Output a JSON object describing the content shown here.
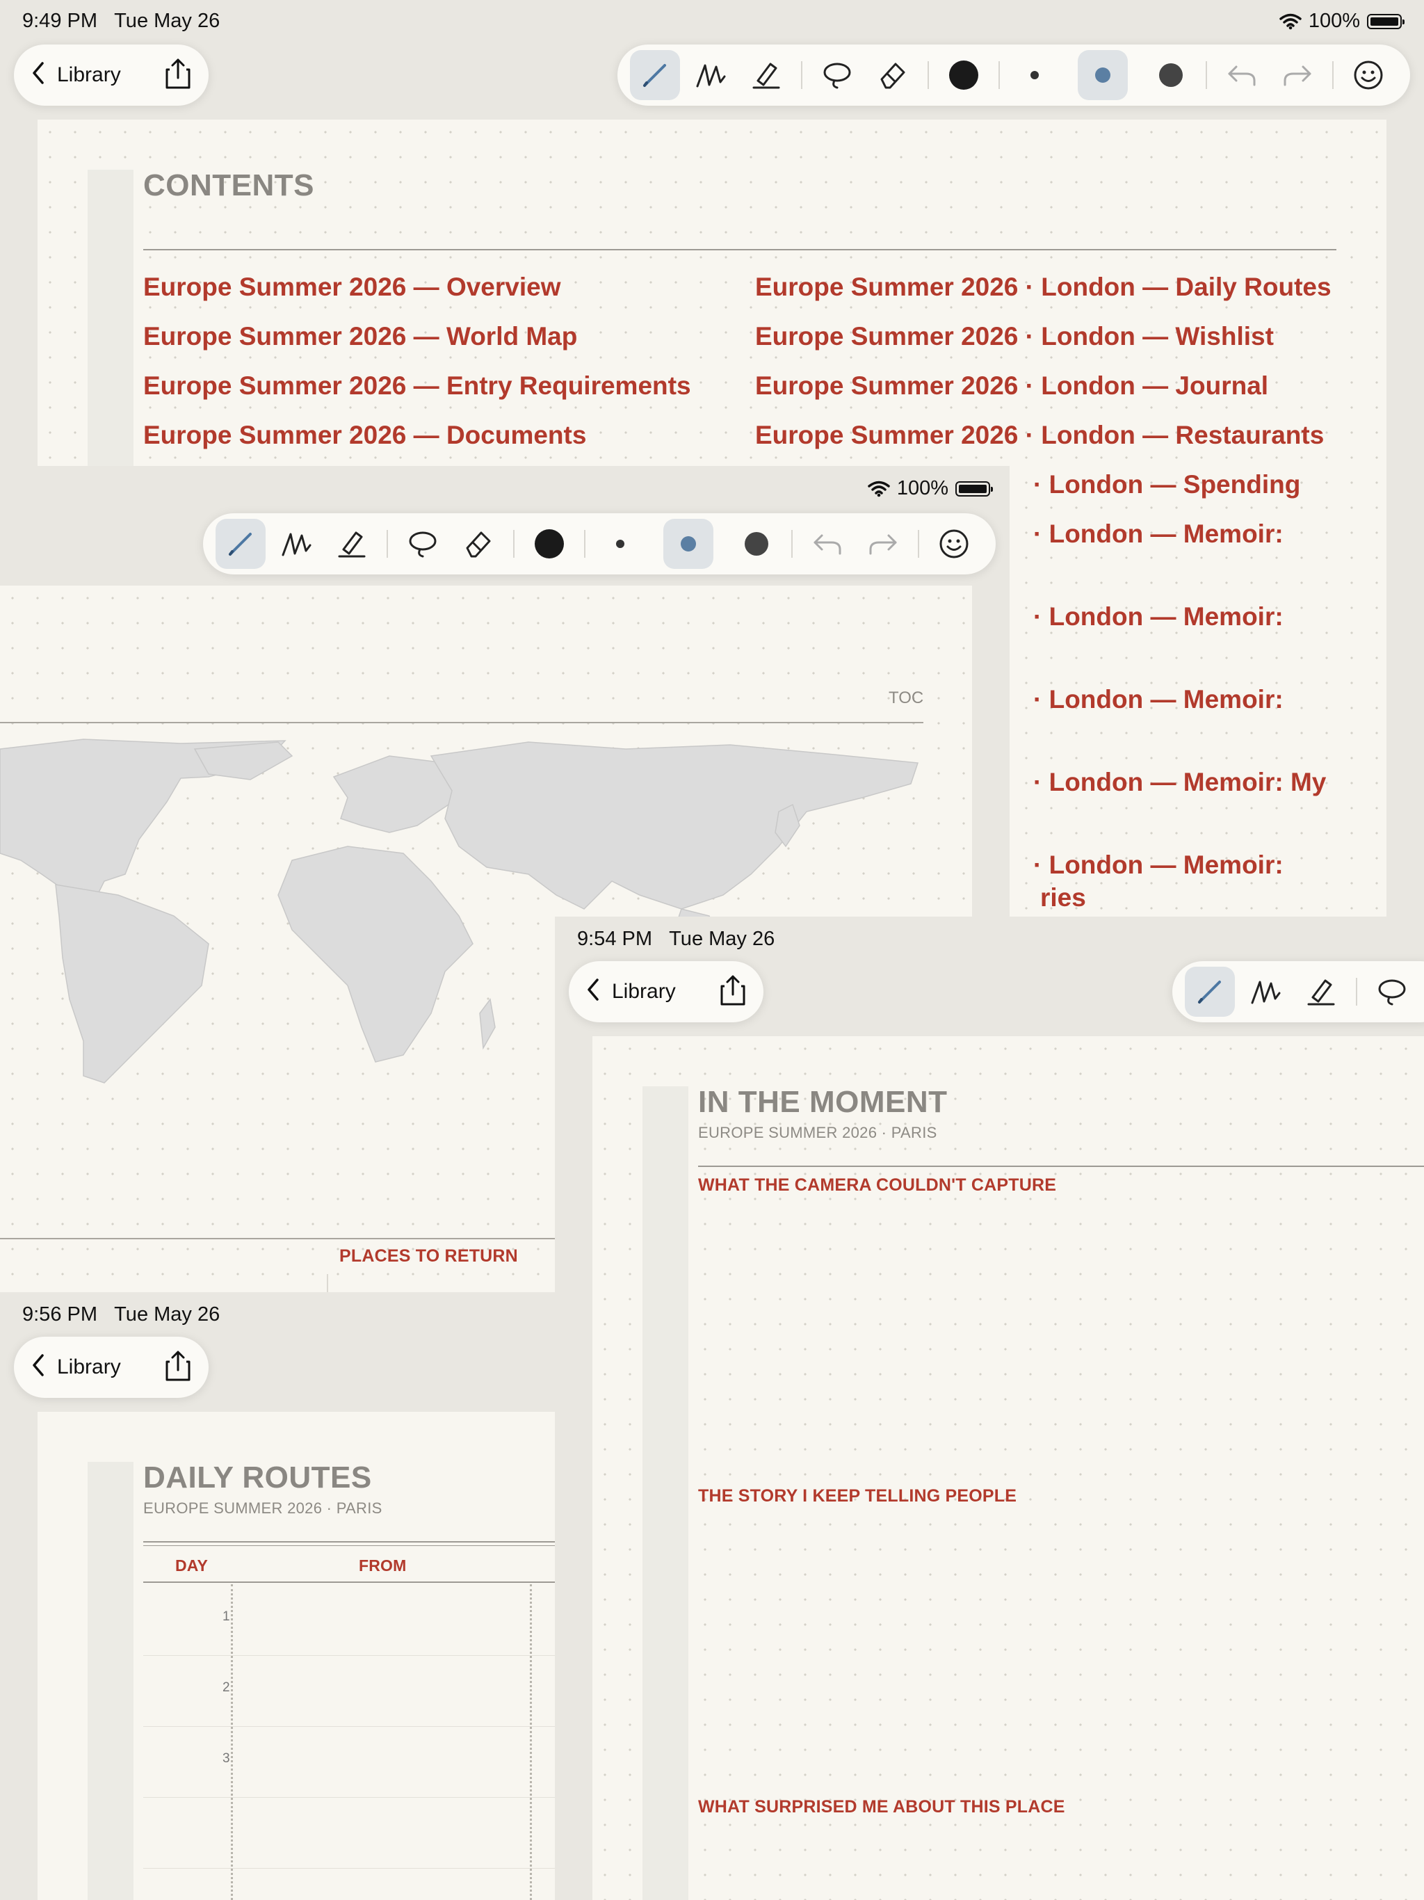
{
  "shot1": {
    "time": "9:49 PM",
    "date": "Tue May 26",
    "battery": "100%",
    "nav": {
      "back_label": "Library"
    },
    "contents": {
      "heading": "CONTENTS",
      "left_links": [
        "Europe Summer 2026 — Overview",
        "Europe Summer 2026 — World Map",
        "Europe Summer 2026 — Entry Requirements",
        "Europe Summer 2026 — Documents"
      ],
      "right_links": [
        "Europe Summer 2026 · London — Daily Routes",
        "Europe Summer 2026 · London — Wishlist",
        "Europe Summer 2026 · London — Journal",
        "Europe Summer 2026 · London — Restaurants",
        "· London — Spending",
        "· London — Memoir:",
        "· London — Memoir:",
        "· London — Memoir:",
        "· London — Memoir: My",
        "· London — Memoir:",
        "ries"
      ]
    }
  },
  "shot2": {
    "battery": "100%",
    "toc_label": "TOC",
    "places_label": "PLACES TO RETURN"
  },
  "shot3": {
    "time": "9:54 PM",
    "date": "Tue May 26",
    "nav": {
      "back_label": "Library"
    },
    "title": "IN THE MOMENT",
    "subtitle": "EUROPE SUMMER 2026  ·  PARIS",
    "sections": [
      "WHAT THE CAMERA COULDN'T CAPTURE",
      "THE STORY I KEEP TELLING PEOPLE",
      "WHAT SURPRISED ME ABOUT THIS PLACE"
    ]
  },
  "shot4": {
    "time": "9:56 PM",
    "date": "Tue May 26",
    "nav": {
      "back_label": "Library"
    },
    "title": "DAILY ROUTES",
    "subtitle": "EUROPE SUMMER 2026  ·  PARIS",
    "columns": [
      "DAY",
      "FROM"
    ],
    "days": [
      "1",
      "2",
      "3"
    ]
  },
  "colors": {
    "accent_red": "#b23a2c",
    "active_blue": "#5b7fa3",
    "paper": "#f8f6f0"
  },
  "icons": [
    "chevron-left-icon",
    "share-icon",
    "pen-icon",
    "marker-icon",
    "highlighter-icon",
    "lasso-icon",
    "eraser-icon",
    "undo-icon",
    "redo-icon",
    "smiley-icon",
    "wifi-icon",
    "battery-icon"
  ]
}
